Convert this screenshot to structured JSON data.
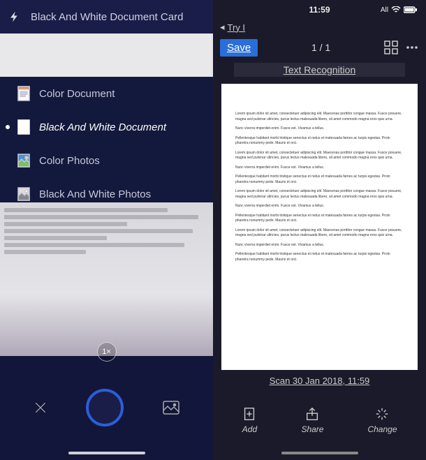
{
  "left": {
    "header_mode": "Black And White Document Card",
    "modes": [
      {
        "label": "Color Document"
      },
      {
        "label": "Black And White Document"
      },
      {
        "label": "Color Photos"
      },
      {
        "label": "Black And White Photos"
      }
    ],
    "zoom": "1×"
  },
  "right": {
    "status_time": "11:59",
    "status_net": "All",
    "back_label": "Try I",
    "save": "Save",
    "page_indicator": "1 / 1",
    "text_recognition": "Text Recognition",
    "doc_name": "Scan 30 Jan 2018, 11:59",
    "actions": {
      "add": "Add",
      "share": "Share",
      "change": "Change"
    },
    "doc_body": [
      "Lorem ipsum dolor sit amet, consectetuer adipiscing elit. Maecenas porttitor congue massa. Fusce posuere, magna sed pulvinar ultricies, purus lectus malesuada libero, sit amet commodo magna eros quis urna.",
      "Nunc viverra imperdiet enim. Fusce est. Vivamus a tellus.",
      "Pellentesque habitant morbi tristique senectus et netus et malesuada fames ac turpis egestas. Proin pharetra nonummy pede. Mauris et orci.",
      "Lorem ipsum dolor sit amet, consectetuer adipiscing elit. Maecenas porttitor congue massa. Fusce posuere, magna sed pulvinar ultricies, purus lectus malesuada libero, sit amet commodo magna eros quis urna.",
      "Nunc viverra imperdiet enim. Fusce est. Vivamus a tellus.",
      "Pellentesque habitant morbi tristique senectus et netus et malesuada fames ac turpis egestas. Proin pharetra nonummy pede. Mauris et orci.",
      "Lorem ipsum dolor sit amet, consectetuer adipiscing elit. Maecenas porttitor congue massa. Fusce posuere, magna sed pulvinar ultricies, purus lectus malesuada libero, sit amet commodo magna eros quis urna.",
      "Nunc viverra imperdiet enim. Fusce est. Vivamus a tellus.",
      "Pellentesque habitant morbi tristique senectus et netus et malesuada fames ac turpis egestas. Proin pharetra nonummy pede. Mauris et orci.",
      "Lorem ipsum dolor sit amet, consectetuer adipiscing elit. Maecenas porttitor congue massa. Fusce posuere, magna sed pulvinar ultricies, purus lectus malesuada libero, sit amet commodo magna eros quis urna.",
      "Nunc viverra imperdiet enim. Fusce est. Vivamus a tellus.",
      "Pellentesque habitant morbi tristique senectus et netus et malesuada fames ac turpis egestas. Proin pharetra nonummy pede. Mauris et orci."
    ]
  }
}
